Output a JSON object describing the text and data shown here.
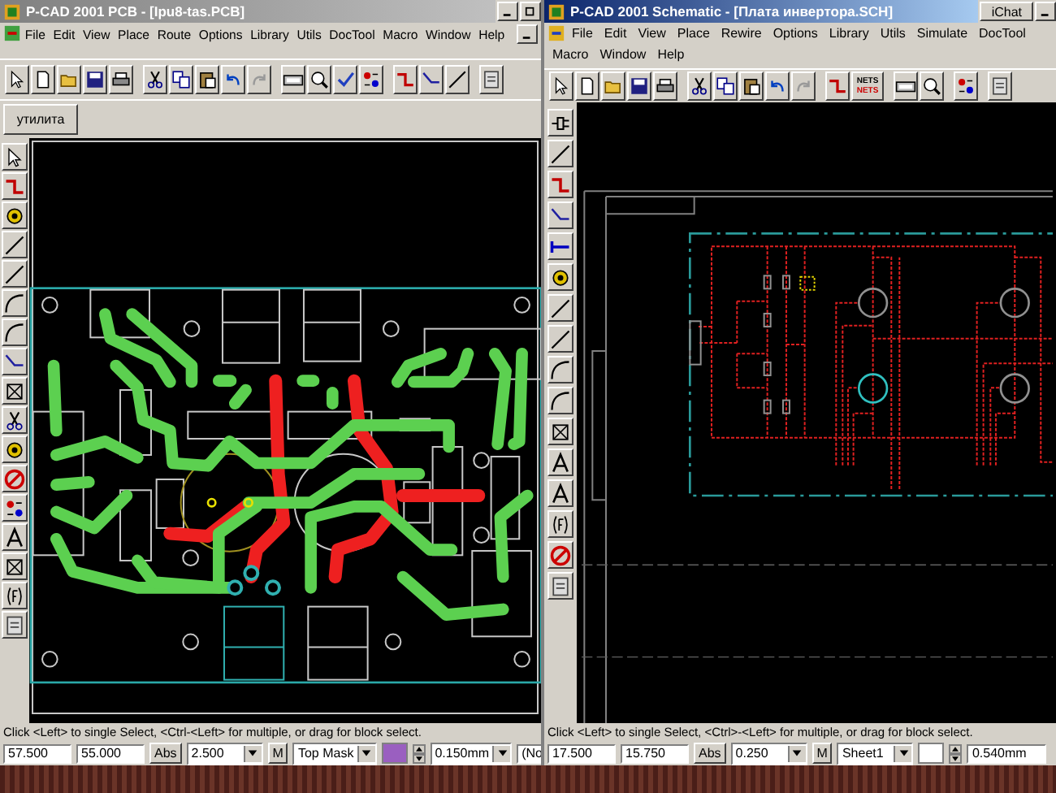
{
  "windows": [
    {
      "title": "P-CAD 2001 PCB - [Ipu8-tas.PCB]",
      "active": false,
      "menu": [
        "File",
        "Edit",
        "View",
        "Place",
        "Route",
        "Options",
        "Library",
        "Utils",
        "DocTool",
        "Macro",
        "Window",
        "Help"
      ],
      "side_button": "утилита",
      "status_message": "Click <Left> to single Select, <Ctrl-<Left> for multiple, or drag for block select.",
      "fields": [
        {
          "kind": "text",
          "value": "57.500"
        },
        {
          "kind": "text",
          "value": "55.000"
        },
        {
          "kind": "button",
          "label": "Abs"
        },
        {
          "kind": "dropdown",
          "value": "2.500"
        },
        {
          "kind": "button",
          "label": "M"
        },
        {
          "kind": "dropdown",
          "value": "Top Mask"
        },
        {
          "kind": "swatch",
          "color": "#9a5fc0"
        },
        {
          "kind": "spinner"
        },
        {
          "kind": "dropdown",
          "value": "0.150mm"
        },
        {
          "kind": "text",
          "value": "(No"
        }
      ]
    },
    {
      "title": "P-CAD 2001 Schematic - [Плата инвертора.SCH]",
      "active": true,
      "menu": [
        "File",
        "Edit",
        "View",
        "Place",
        "Rewire",
        "Options",
        "Library",
        "Utils",
        "Simulate",
        "DocTool",
        "Macro",
        "Window",
        "Help"
      ],
      "chat_button": "iChat",
      "nets_icon": [
        "NETS",
        "NETS"
      ],
      "status_message": "Click <Left> to single Select, <Ctrl>-<Left> for multiple, or drag for block select.",
      "fields": [
        {
          "kind": "text",
          "value": "17.500"
        },
        {
          "kind": "text",
          "value": "15.750"
        },
        {
          "kind": "button",
          "label": "Abs"
        },
        {
          "kind": "dropdown",
          "value": "0.250"
        },
        {
          "kind": "button",
          "label": "M"
        },
        {
          "kind": "dropdown",
          "value": "Sheet1"
        },
        {
          "kind": "swatch",
          "color": "#ffffff"
        },
        {
          "kind": "spinner"
        },
        {
          "kind": "text",
          "value": "0.540mm"
        }
      ]
    }
  ]
}
